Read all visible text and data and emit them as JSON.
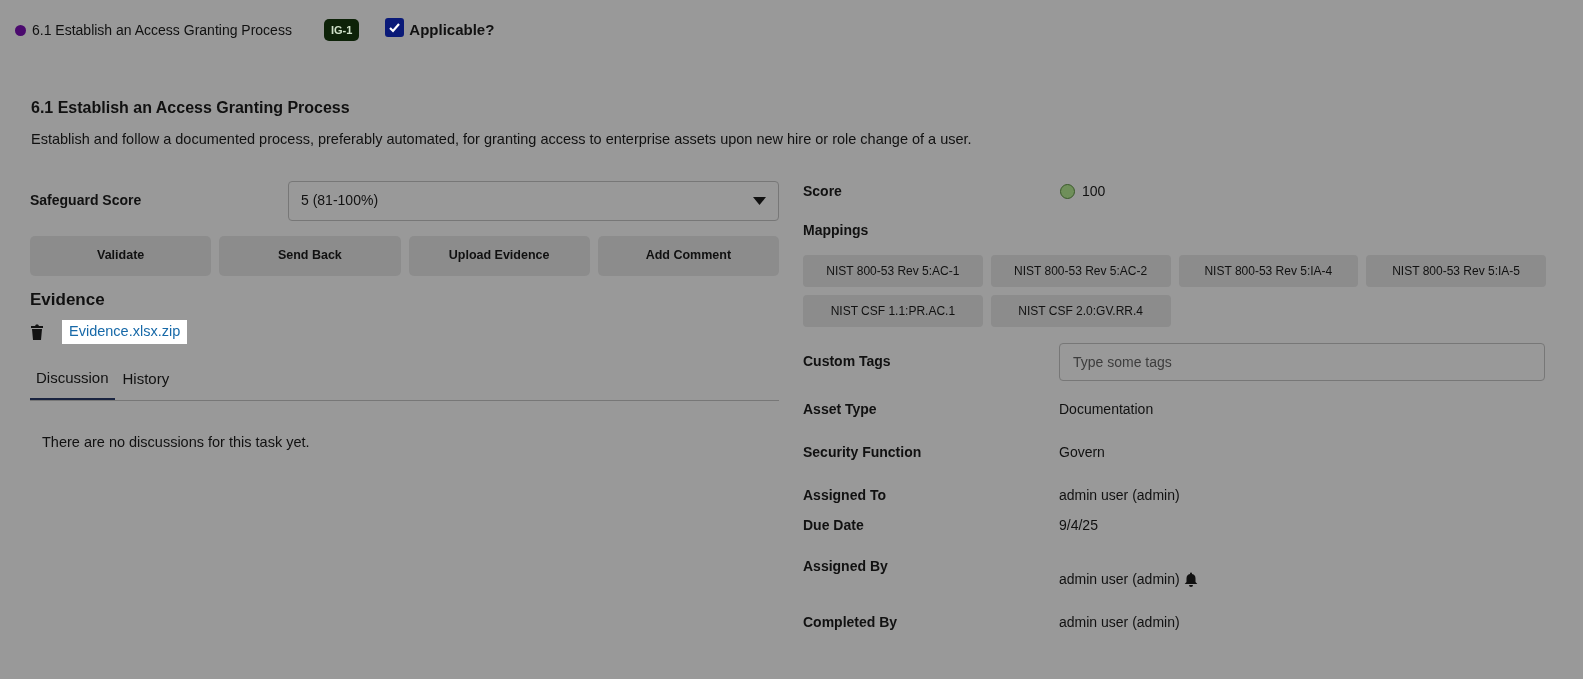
{
  "header": {
    "title": "6.1 Establish an Access Granting Process",
    "badge": "IG-1",
    "applicable": {
      "label": "Applicable?",
      "checked": true
    }
  },
  "safeguard": {
    "title": "6.1 Establish an Access Granting Process",
    "description": "Establish and follow a documented process, preferably automated, for granting access to enterprise assets upon new hire or role change of a user."
  },
  "safeguard_score": {
    "label": "Safeguard Score",
    "value": "5 (81-100%)"
  },
  "actions": [
    "Validate",
    "Send Back",
    "Upload Evidence",
    "Add Comment"
  ],
  "evidence": {
    "title": "Evidence",
    "files": [
      "Evidence.xlsx.zip"
    ]
  },
  "tabs": [
    {
      "label": "Discussion",
      "selected": true
    },
    {
      "label": "History",
      "selected": false
    }
  ],
  "discussion_empty": "There are no discussions for this task yet.",
  "score": {
    "label": "Score",
    "value": "100",
    "color": "#6f8f5a"
  },
  "mappings": {
    "label": "Mappings",
    "items": [
      "NIST 800-53 Rev 5:AC-1",
      "NIST 800-53 Rev 5:AC-2",
      "NIST 800-53 Rev 5:IA-4",
      "NIST 800-53 Rev 5:IA-5",
      "NIST CSF 1.1:PR.AC.1",
      "NIST CSF 2.0:GV.RR.4"
    ]
  },
  "custom_tags": {
    "label": "Custom Tags",
    "placeholder": "Type some tags"
  },
  "details": [
    {
      "label": "Asset Type",
      "value": "Documentation",
      "bell": false
    },
    {
      "label": "Security Function",
      "value": "Govern",
      "bell": false
    },
    {
      "label": "Assigned To",
      "value": "admin user (admin)",
      "bell": false
    },
    {
      "label": "Due Date",
      "value": "9/4/25",
      "bell": false
    },
    {
      "label": "Assigned By",
      "value": "admin user (admin)",
      "bell": true
    },
    {
      "label": "Completed By",
      "value": "admin user (admin)",
      "bell": false
    }
  ]
}
